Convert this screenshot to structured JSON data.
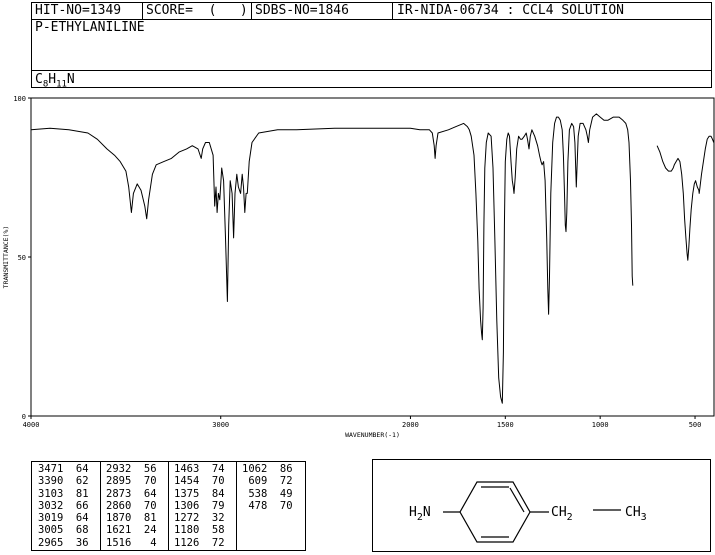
{
  "header": {
    "hit_no": "HIT-NO=1349",
    "score": "SCORE=  (   )",
    "sdbs_no": "SDBS-NO=1846",
    "ir_code": "IR-NIDA-06734 : CCL4 SOLUTION",
    "compound_name": "P-ETHYLANILINE",
    "formula": {
      "c": "C",
      "c_n": "8",
      "h": "H",
      "h_n": "11",
      "n": "N"
    }
  },
  "chart_data": {
    "type": "line",
    "xlabel": "WAVENUMBER(-1)",
    "ylabel": "TRANSMITTANCE(%)",
    "xlim": [
      4000,
      400
    ],
    "ylim": [
      0,
      100
    ],
    "x_ticks": [
      4000,
      3000,
      2000,
      1500,
      1000,
      500
    ],
    "y_ticks": [
      0,
      50,
      100
    ],
    "grid": false,
    "series": [
      {
        "segments": [
          [
            [
              4000,
              90
            ],
            [
              3900,
              90.5
            ],
            [
              3800,
              90
            ],
            [
              3700,
              89
            ],
            [
              3650,
              87
            ],
            [
              3600,
              84
            ],
            [
              3560,
              82
            ],
            [
              3530,
              80
            ],
            [
              3500,
              77
            ],
            [
              3485,
              72
            ],
            [
              3471,
              64
            ],
            [
              3460,
              70
            ],
            [
              3440,
              73
            ],
            [
              3420,
              71
            ],
            [
              3400,
              66
            ],
            [
              3390,
              62
            ],
            [
              3380,
              68
            ],
            [
              3360,
              76
            ],
            [
              3340,
              79
            ],
            [
              3300,
              80
            ],
            [
              3260,
              81
            ],
            [
              3220,
              83
            ],
            [
              3180,
              84
            ],
            [
              3150,
              85
            ],
            [
              3120,
              84
            ],
            [
              3103,
              81
            ],
            [
              3095,
              84
            ],
            [
              3080,
              86
            ],
            [
              3060,
              86
            ],
            [
              3040,
              82
            ],
            [
              3032,
              66
            ],
            [
              3025,
              72
            ],
            [
              3019,
              64
            ],
            [
              3012,
              70
            ],
            [
              3005,
              68
            ],
            [
              2995,
              78
            ],
            [
              2985,
              74
            ],
            [
              2975,
              56
            ],
            [
              2965,
              36
            ],
            [
              2958,
              60
            ],
            [
              2950,
              74
            ],
            [
              2940,
              70
            ],
            [
              2932,
              56
            ],
            [
              2925,
              70
            ],
            [
              2915,
              76
            ],
            [
              2907,
              72
            ],
            [
              2895,
              70
            ],
            [
              2887,
              76
            ],
            [
              2880,
              72
            ],
            [
              2873,
              64
            ],
            [
              2866,
              70
            ],
            [
              2860,
              70
            ],
            [
              2850,
              80
            ],
            [
              2835,
              86
            ],
            [
              2800,
              89
            ],
            [
              2700,
              90
            ],
            [
              2600,
              90
            ],
            [
              2400,
              90.5
            ],
            [
              2200,
              90.5
            ],
            [
              2000,
              90.5
            ],
            [
              1950,
              90
            ],
            [
              1900,
              90
            ],
            [
              1885,
              89
            ],
            [
              1875,
              85
            ],
            [
              1870,
              81
            ],
            [
              1865,
              85
            ],
            [
              1855,
              89
            ],
            [
              1800,
              90
            ],
            [
              1760,
              91
            ],
            [
              1720,
              92
            ],
            [
              1700,
              91
            ],
            [
              1690,
              90
            ],
            [
              1680,
              88
            ],
            [
              1665,
              82
            ],
            [
              1655,
              70
            ],
            [
              1645,
              55
            ],
            [
              1638,
              40
            ],
            [
              1630,
              30
            ],
            [
              1625,
              26
            ],
            [
              1621,
              24
            ],
            [
              1617,
              34
            ],
            [
              1613,
              60
            ],
            [
              1608,
              78
            ],
            [
              1600,
              86
            ],
            [
              1590,
              89
            ],
            [
              1575,
              88
            ],
            [
              1565,
              78
            ],
            [
              1555,
              55
            ],
            [
              1545,
              30
            ],
            [
              1535,
              12
            ],
            [
              1525,
              6
            ],
            [
              1516,
              4
            ],
            [
              1510,
              20
            ],
            [
              1505,
              60
            ],
            [
              1500,
              80
            ],
            [
              1492,
              87
            ],
            [
              1485,
              89
            ],
            [
              1478,
              88
            ],
            [
              1470,
              80
            ],
            [
              1463,
              74
            ],
            [
              1458,
              72
            ],
            [
              1454,
              70
            ],
            [
              1448,
              75
            ],
            [
              1440,
              84
            ],
            [
              1430,
              88
            ],
            [
              1420,
              87
            ],
            [
              1412,
              87
            ],
            [
              1400,
              88
            ],
            [
              1390,
              89
            ],
            [
              1383,
              87
            ],
            [
              1375,
              84
            ],
            [
              1368,
              88
            ],
            [
              1360,
              90
            ],
            [
              1345,
              88
            ],
            [
              1330,
              85
            ],
            [
              1320,
              82
            ],
            [
              1312,
              80
            ],
            [
              1306,
              79
            ],
            [
              1298,
              80
            ],
            [
              1290,
              74
            ],
            [
              1282,
              56
            ],
            [
              1276,
              40
            ],
            [
              1272,
              32
            ],
            [
              1267,
              44
            ],
            [
              1260,
              70
            ],
            [
              1250,
              86
            ],
            [
              1240,
              92
            ],
            [
              1230,
              94
            ],
            [
              1220,
              94
            ],
            [
              1210,
              93
            ],
            [
              1200,
              90
            ],
            [
              1194,
              82
            ],
            [
              1188,
              70
            ],
            [
              1184,
              60
            ],
            [
              1180,
              58
            ],
            [
              1176,
              64
            ],
            [
              1170,
              80
            ],
            [
              1162,
              90
            ],
            [
              1150,
              92
            ],
            [
              1140,
              91
            ],
            [
              1133,
              86
            ],
            [
              1129,
              78
            ],
            [
              1126,
              72
            ],
            [
              1122,
              78
            ],
            [
              1116,
              88
            ],
            [
              1106,
              92
            ],
            [
              1090,
              92
            ],
            [
              1075,
              90
            ],
            [
              1068,
              88
            ],
            [
              1062,
              86
            ],
            [
              1055,
              90
            ],
            [
              1040,
              94
            ],
            [
              1020,
              95
            ],
            [
              1000,
              94
            ],
            [
              980,
              93
            ],
            [
              960,
              93
            ],
            [
              930,
              94
            ],
            [
              900,
              94
            ],
            [
              880,
              93
            ],
            [
              865,
              92
            ],
            [
              855,
              90
            ],
            [
              848,
              86
            ],
            [
              840,
              74
            ],
            [
              835,
              60
            ],
            [
              831,
              44
            ],
            [
              828,
              41
            ]
          ],
          [
            [
              700,
              85
            ],
            [
              685,
              83
            ],
            [
              670,
              80
            ],
            [
              655,
              78
            ],
            [
              640,
              77
            ],
            [
              625,
              77
            ],
            [
              615,
              78
            ],
            [
              609,
              79
            ],
            [
              600,
              80
            ],
            [
              590,
              81
            ],
            [
              580,
              80
            ],
            [
              570,
              76
            ],
            [
              562,
              70
            ],
            [
              555,
              62
            ],
            [
              548,
              56
            ],
            [
              542,
              51
            ],
            [
              538,
              49
            ],
            [
              533,
              53
            ],
            [
              527,
              59
            ],
            [
              520,
              65
            ],
            [
              512,
              70
            ],
            [
              504,
              73
            ],
            [
              497,
              74
            ],
            [
              488,
              72
            ],
            [
              480,
              71
            ],
            [
              478,
              70
            ],
            [
              474,
              72
            ],
            [
              466,
              76
            ],
            [
              456,
              80
            ],
            [
              446,
              84
            ],
            [
              436,
              87
            ],
            [
              426,
              88
            ],
            [
              416,
              88
            ],
            [
              408,
              87
            ],
            [
              401,
              86
            ]
          ]
        ]
      }
    ],
    "peak_table": [
      [
        [
          3471,
          64
        ],
        [
          3390,
          62
        ],
        [
          3103,
          81
        ],
        [
          3032,
          66
        ],
        [
          3019,
          64
        ],
        [
          3005,
          68
        ],
        [
          2965,
          36
        ]
      ],
      [
        [
          2932,
          56
        ],
        [
          2895,
          70
        ],
        [
          2873,
          64
        ],
        [
          2860,
          70
        ],
        [
          1870,
          81
        ],
        [
          1621,
          24
        ],
        [
          1516,
          4
        ]
      ],
      [
        [
          1463,
          74
        ],
        [
          1454,
          70
        ],
        [
          1375,
          84
        ],
        [
          1306,
          79
        ],
        [
          1272,
          32
        ],
        [
          1180,
          58
        ],
        [
          1126,
          72
        ]
      ],
      [
        [
          1062,
          86
        ],
        [
          609,
          72
        ],
        [
          538,
          49
        ],
        [
          478,
          70
        ]
      ]
    ]
  },
  "structure": {
    "left_group": "H2N",
    "left_main": "H",
    "left_sub": "2",
    "left_tail": "N",
    "right_group1": "CH2",
    "right1_main": "CH",
    "right1_sub": "2",
    "right_group2": "CH3",
    "right2_main": "CH",
    "right2_sub": "3"
  }
}
